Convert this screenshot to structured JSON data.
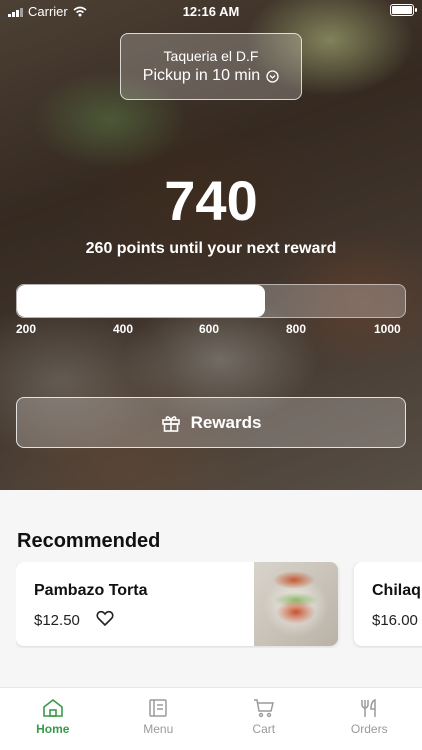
{
  "status_bar": {
    "carrier": "Carrier",
    "time": "12:16 AM"
  },
  "store": {
    "name": "Taqueria el D.F",
    "pickup": "Pickup in 10 min"
  },
  "points": {
    "value": "740",
    "subtitle": "260 points until your next reward",
    "progress_fraction": 0.64,
    "ticks": [
      "200",
      "400",
      "600",
      "800",
      "1000"
    ]
  },
  "rewards_button": {
    "label": "Rewards",
    "icon": "gift-icon"
  },
  "recommended": {
    "title": "Recommended",
    "items": [
      {
        "name": "Pambazo Torta",
        "price": "$12.50"
      },
      {
        "name": "Chilaq",
        "price": "$16.00"
      }
    ]
  },
  "tabs": [
    {
      "label": "Home",
      "icon": "home-icon",
      "active": true
    },
    {
      "label": "Menu",
      "icon": "menu-icon",
      "active": false
    },
    {
      "label": "Cart",
      "icon": "cart-icon",
      "active": false
    },
    {
      "label": "Orders",
      "icon": "utensils-icon",
      "active": false
    }
  ],
  "colors": {
    "accent": "#3a9a4a"
  }
}
